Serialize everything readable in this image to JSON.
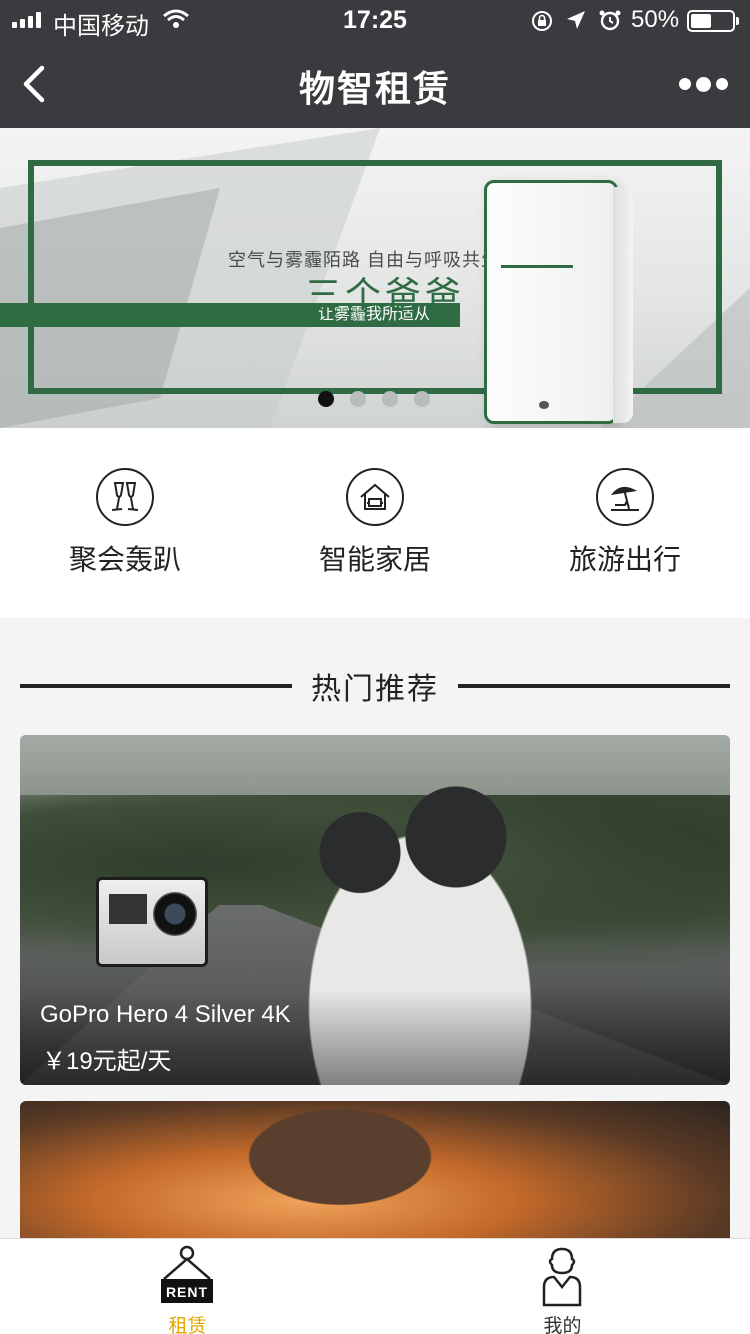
{
  "status_bar": {
    "carrier": "中国移动",
    "time": "17:25",
    "battery": "50%",
    "battery_level": 0.5
  },
  "nav": {
    "title": "物智租赁"
  },
  "banner": {
    "tagline": "空气与雾霾陌路 自由与呼吸共生",
    "brand": "三个爸爸",
    "slogan": "让雾霾我所适从",
    "slide_count": 4,
    "active_slide": 1,
    "accent_color": "#2f6b43"
  },
  "categories": [
    {
      "label": "聚会轰趴",
      "icon": "champagne-icon"
    },
    {
      "label": "智能家居",
      "icon": "smart-home-icon"
    },
    {
      "label": "旅游出行",
      "icon": "beach-umbrella-icon"
    }
  ],
  "section": {
    "title": "热门推荐"
  },
  "products": [
    {
      "name": "GoPro Hero 4 Silver 4K",
      "price": "￥19元起/天"
    }
  ],
  "tab_bar": {
    "rent_label": "租赁",
    "rent_badge": "RENT",
    "mine_label": "我的",
    "active_color": "#e2a700"
  }
}
